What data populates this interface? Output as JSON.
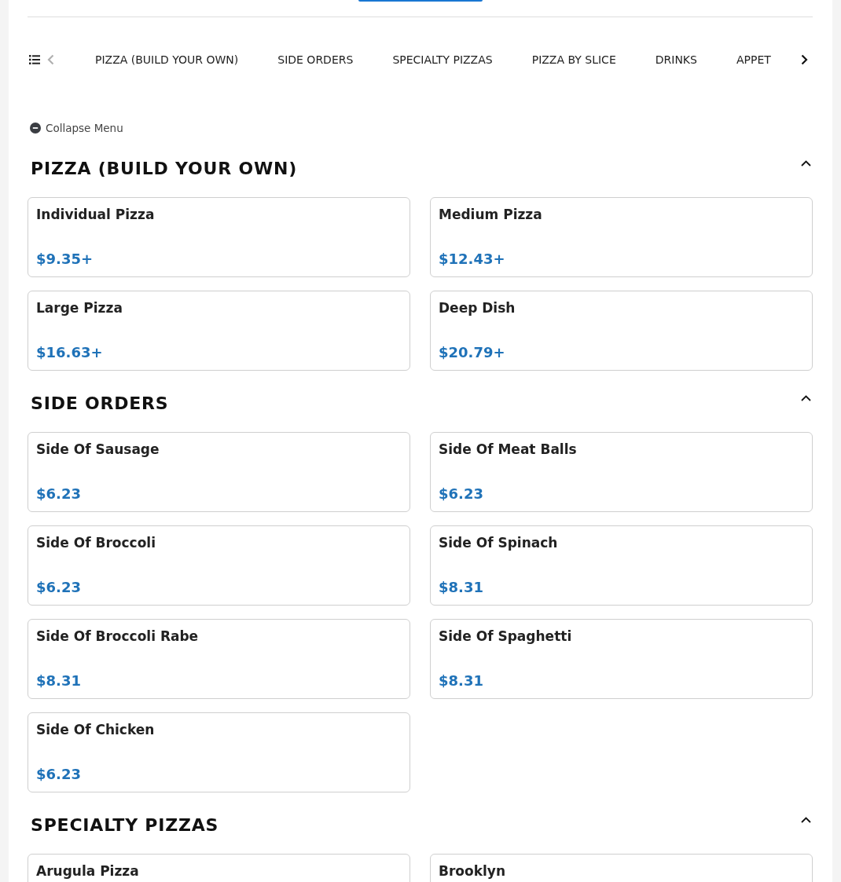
{
  "category_nav": {
    "scroll_left": {
      "disabled": true
    },
    "tabs": [
      {
        "label": "PIZZA (BUILD YOUR OWN)"
      },
      {
        "label": "SIDE ORDERS"
      },
      {
        "label": "SPECIALTY PIZZAS"
      },
      {
        "label": "PIZZA BY SLICE"
      },
      {
        "label": "DRINKS"
      },
      {
        "label": "APPET"
      }
    ],
    "scroll_right": {
      "disabled": false
    }
  },
  "collapse_menu": {
    "label": "Collapse Menu"
  },
  "sections": [
    {
      "title": "PIZZA (BUILD YOUR OWN)",
      "expanded": true,
      "items": [
        {
          "name": "Individual Pizza",
          "price": "$9.35+"
        },
        {
          "name": "Medium Pizza",
          "price": "$12.43+"
        },
        {
          "name": "Large Pizza",
          "price": "$16.63+"
        },
        {
          "name": "Deep Dish",
          "price": "$20.79+"
        }
      ]
    },
    {
      "title": "SIDE ORDERS",
      "expanded": true,
      "items": [
        {
          "name": "Side Of Sausage",
          "price": "$6.23"
        },
        {
          "name": "Side Of Meat Balls",
          "price": "$6.23"
        },
        {
          "name": "Side Of Broccoli",
          "price": "$6.23"
        },
        {
          "name": "Side Of Spinach",
          "price": "$8.31"
        },
        {
          "name": "Side Of Broccoli Rabe",
          "price": "$8.31"
        },
        {
          "name": "Side Of Spaghetti",
          "price": "$8.31"
        },
        {
          "name": "Side Of Chicken",
          "price": "$6.23"
        }
      ]
    },
    {
      "title": "SPECIALTY PIZZAS",
      "expanded": true,
      "items": [
        {
          "name": "Arugula Pizza"
        },
        {
          "name": "Brooklyn"
        }
      ]
    }
  ]
}
